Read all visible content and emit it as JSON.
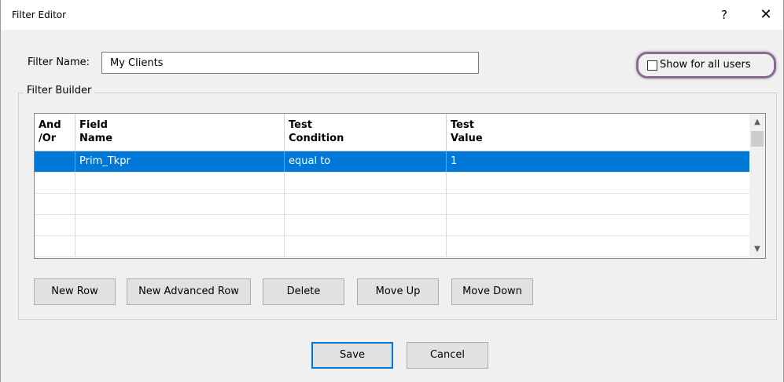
{
  "window": {
    "title": "Filter Editor",
    "help": "?",
    "close": "✕"
  },
  "filter_name": {
    "label": "Filter Name:",
    "value": "My Clients"
  },
  "show_for_all": {
    "label": "Show for all users",
    "checked": false
  },
  "filter_builder": {
    "legend": "Filter Builder",
    "columns": [
      "And\n/Or",
      "Field\nName",
      "Test\nCondition",
      "Test\nValue"
    ],
    "columns_line1": [
      "And",
      "Field",
      "Test",
      "Test"
    ],
    "columns_line2": [
      "/Or",
      "Name",
      "Condition",
      "Value"
    ],
    "rows": [
      {
        "andor": "",
        "field": "Prim_Tkpr",
        "condition": "equal to",
        "value": "1",
        "selected": true
      },
      {
        "andor": "",
        "field": "",
        "condition": "",
        "value": "",
        "selected": false
      },
      {
        "andor": "",
        "field": "",
        "condition": "",
        "value": "",
        "selected": false
      },
      {
        "andor": "",
        "field": "",
        "condition": "",
        "value": "",
        "selected": false
      },
      {
        "andor": "",
        "field": "",
        "condition": "",
        "value": "",
        "selected": false
      }
    ]
  },
  "buttons": {
    "new_row": "New Row",
    "new_advanced_row": "New Advanced Row",
    "delete": "Delete",
    "move_up": "Move Up",
    "move_down": "Move Down",
    "save": "Save",
    "cancel": "Cancel"
  },
  "colors": {
    "selection": "#0078d7",
    "highlight_ring": "#8a6a93"
  }
}
